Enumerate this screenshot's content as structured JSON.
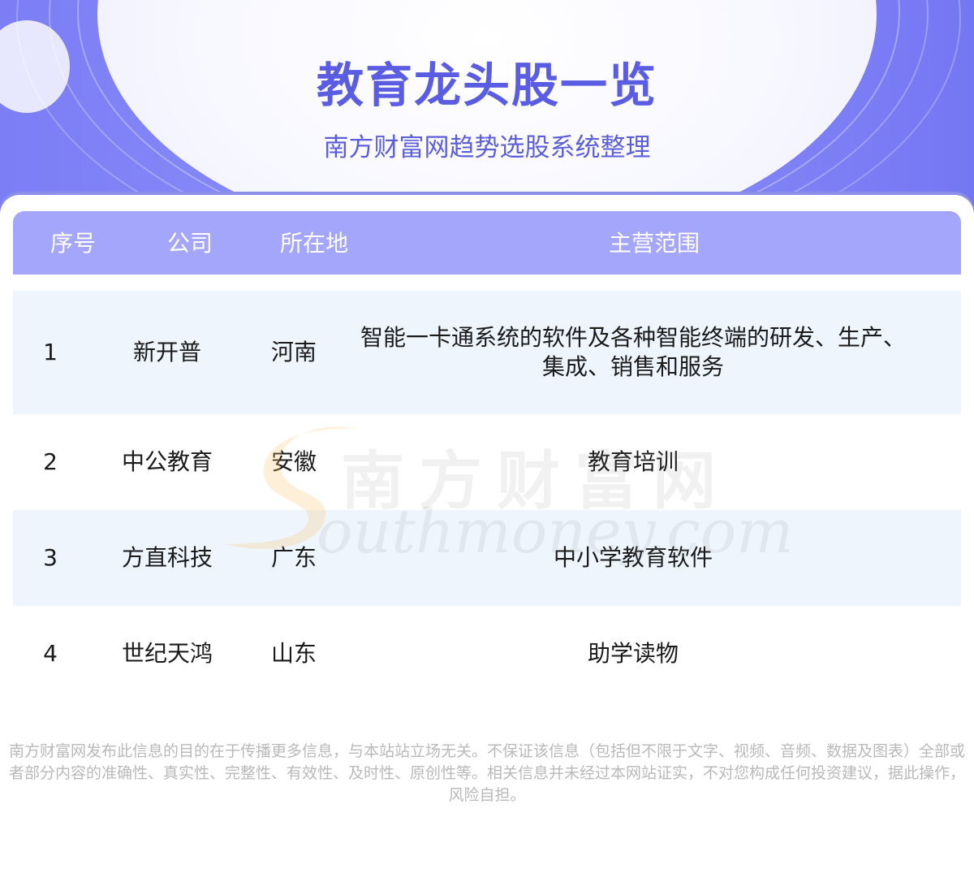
{
  "header": {
    "title": "教育龙头股一览",
    "subtitle": "南方财富网趋势选股系统整理"
  },
  "table": {
    "columns": [
      "序号",
      "公司",
      "所在地",
      "主营范围"
    ],
    "rows": [
      {
        "index": "1",
        "company": "新开普",
        "location": "河南",
        "business": "智能一卡通系统的软件及各种智能终端的研发、生产、集成、销售和服务"
      },
      {
        "index": "2",
        "company": "中公教育",
        "location": "安徽",
        "business": "教育培训"
      },
      {
        "index": "3",
        "company": "方直科技",
        "location": "广东",
        "business": "中小学教育软件"
      },
      {
        "index": "4",
        "company": "世纪天鸿",
        "location": "山东",
        "business": "助学读物"
      }
    ]
  },
  "watermark": {
    "cn": "南方财富网",
    "en": "outhmoney.com"
  },
  "disclaimer": "南方财富网发布此信息的目的在于传播更多信息，与本站站立场无关。不保证该信息（包括但不限于文字、视频、音频、数据及图表）全部或者部分内容的准确性、真实性、完整性、有效性、及时性、原创性等。相关信息并未经过本网站证实，不对您构成任何投资建议，据此操作，风险自担。",
  "colors": {
    "accent": "#5a5de2",
    "header_row": "#a4a6fb",
    "alt_row": "#eef5fd"
  }
}
